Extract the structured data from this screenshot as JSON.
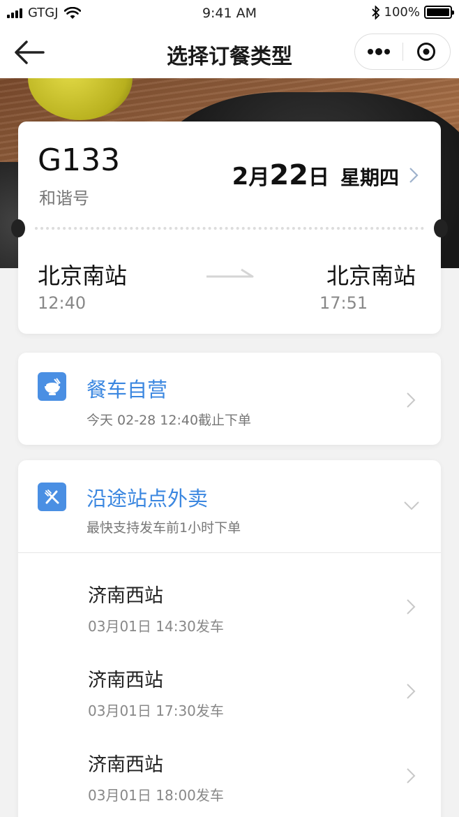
{
  "status_bar": {
    "carrier": "GTGJ",
    "time": "9:41 AM",
    "battery_text": "100%",
    "battery_level": 1.0,
    "icons": [
      "signal-icon",
      "wifi-icon",
      "bluetooth-icon",
      "battery-icon"
    ]
  },
  "nav": {
    "title": "选择订餐类型",
    "back_icon": "back-arrow-icon",
    "more_icon": "more-dots-icon",
    "close_icon": "target-circle-icon"
  },
  "train": {
    "number": "G133",
    "type": "和谐号",
    "date": {
      "month": "2",
      "month_unit": "月",
      "day": "22",
      "day_unit": "日"
    },
    "weekday": "星期四",
    "from": {
      "station": "北京南站",
      "time": "12:40"
    },
    "to": {
      "station": "北京南站",
      "time": "17:51"
    }
  },
  "dining_car": {
    "icon": "rice-bowl-icon",
    "title": "餐车自营",
    "subtitle": "今天 02-28 12:40截止下单"
  },
  "delivery": {
    "icon": "fork-knife-icon",
    "title": "沿途站点外卖",
    "subtitle": "最快支持发车前1小时下单",
    "expanded": true,
    "stops": [
      {
        "name": "济南西站",
        "time": "03月01日 14:30发车"
      },
      {
        "name": "济南西站",
        "time": "03月01日 17:30发车"
      },
      {
        "name": "济南西站",
        "time": "03月01日 18:00发车"
      }
    ]
  },
  "colors": {
    "accent": "#3b87e0",
    "icon_bg": "#4a8fe3",
    "page_bg": "#f2f2f2"
  }
}
